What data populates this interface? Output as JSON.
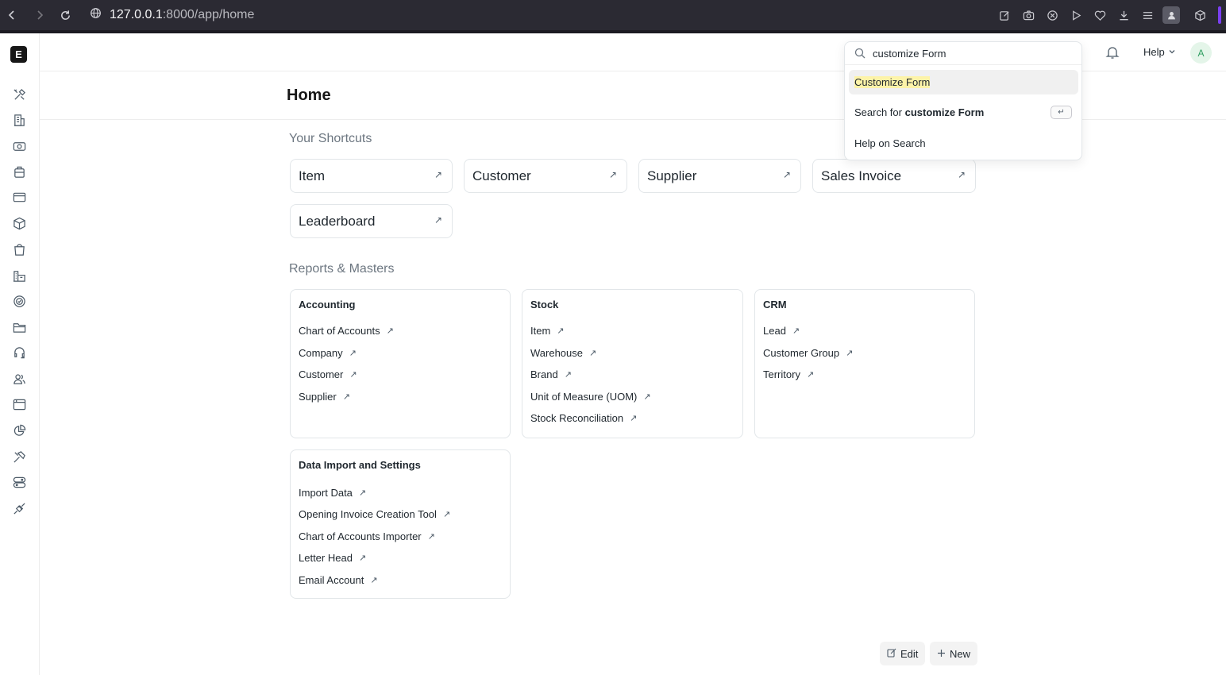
{
  "browser": {
    "url_host": "127.0.0.1",
    "url_path": ":8000/app/home"
  },
  "app": {
    "logo_letter": "E",
    "help_label": "Help",
    "avatar_initial": "A"
  },
  "page": {
    "title": "Home"
  },
  "search": {
    "query": "customize Form",
    "results": [
      {
        "label": "Customize Form"
      },
      {
        "prefix": "Search for ",
        "term": "customize Form"
      },
      {
        "label": "Help on Search"
      }
    ]
  },
  "shortcuts": {
    "title": "Your Shortcuts",
    "items": [
      "Item",
      "Customer",
      "Supplier",
      "Sales Invoice",
      "Leaderboard"
    ]
  },
  "reports": {
    "title": "Reports & Masters",
    "cards": [
      {
        "title": "Accounting",
        "links": [
          "Chart of Accounts",
          "Company",
          "Customer",
          "Supplier"
        ]
      },
      {
        "title": "Stock",
        "links": [
          "Item",
          "Warehouse",
          "Brand",
          "Unit of Measure (UOM)",
          "Stock Reconciliation"
        ]
      },
      {
        "title": "CRM",
        "links": [
          "Lead",
          "Customer Group",
          "Territory"
        ]
      },
      {
        "title": "Data Import and Settings",
        "links": [
          "Import Data",
          "Opening Invoice Creation Tool",
          "Chart of Accounts Importer",
          "Letter Head",
          "Email Account"
        ]
      }
    ]
  },
  "actions": {
    "edit_label": "Edit",
    "new_label": "New"
  }
}
